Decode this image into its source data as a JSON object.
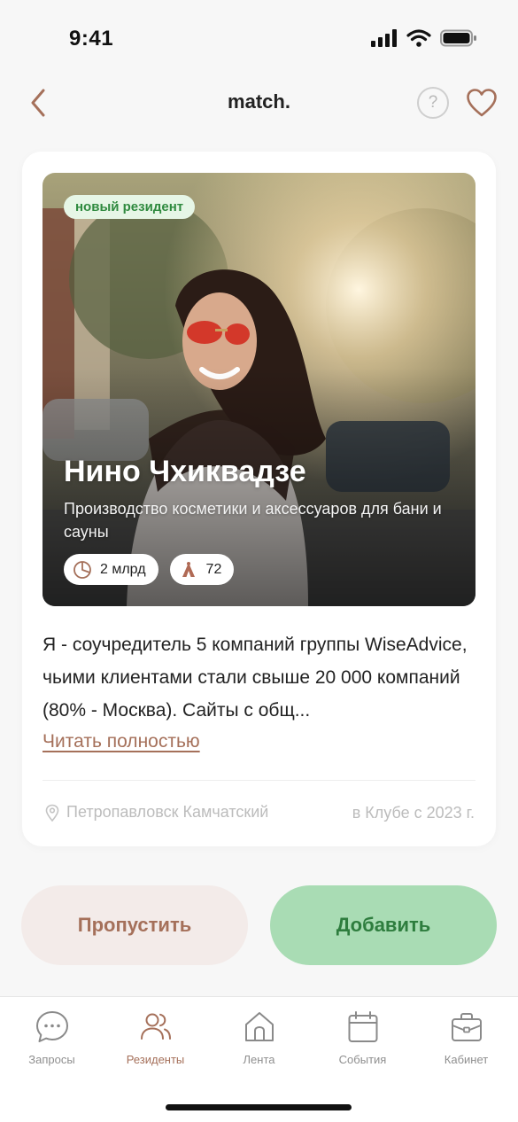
{
  "status_bar": {
    "time": "9:41"
  },
  "header": {
    "title": "match.",
    "help_label": "?"
  },
  "profile": {
    "badge": "новый резидент",
    "name": "Нино Чхиквадзе",
    "description": "Производство косметики и аксессуаров для бани и сауны",
    "stats": [
      {
        "icon": "pie-chart-icon",
        "value": "2 млрд"
      },
      {
        "icon": "rank-icon",
        "value": "72"
      }
    ],
    "bio": "Я - соучредитель 5 компаний группы WiseAdvice, чьими клиентами стали свыше 20 000 компаний (80% - Москва). Сайты с общ...",
    "read_more": "Читать полностью",
    "location": "Петропавловск Камчатский",
    "member_since": "в Клубе с 2023 г."
  },
  "actions": {
    "skip": "Пропустить",
    "add": "Добавить"
  },
  "tab_bar": {
    "tabs": [
      {
        "label": "Запросы",
        "icon": "chat-icon",
        "active": false
      },
      {
        "label": "Резиденты",
        "icon": "users-icon",
        "active": true
      },
      {
        "label": "Лента",
        "icon": "home-icon",
        "active": false
      },
      {
        "label": "События",
        "icon": "calendar-icon",
        "active": false
      },
      {
        "label": "Кабинет",
        "icon": "briefcase-icon",
        "active": false
      }
    ]
  },
  "colors": {
    "accent_brown": "#a5705a",
    "accent_green": "#2e7d3e",
    "add_bg": "#a9dcb4",
    "skip_bg": "#f3ebe9",
    "badge_bg": "#e6f6e6"
  }
}
